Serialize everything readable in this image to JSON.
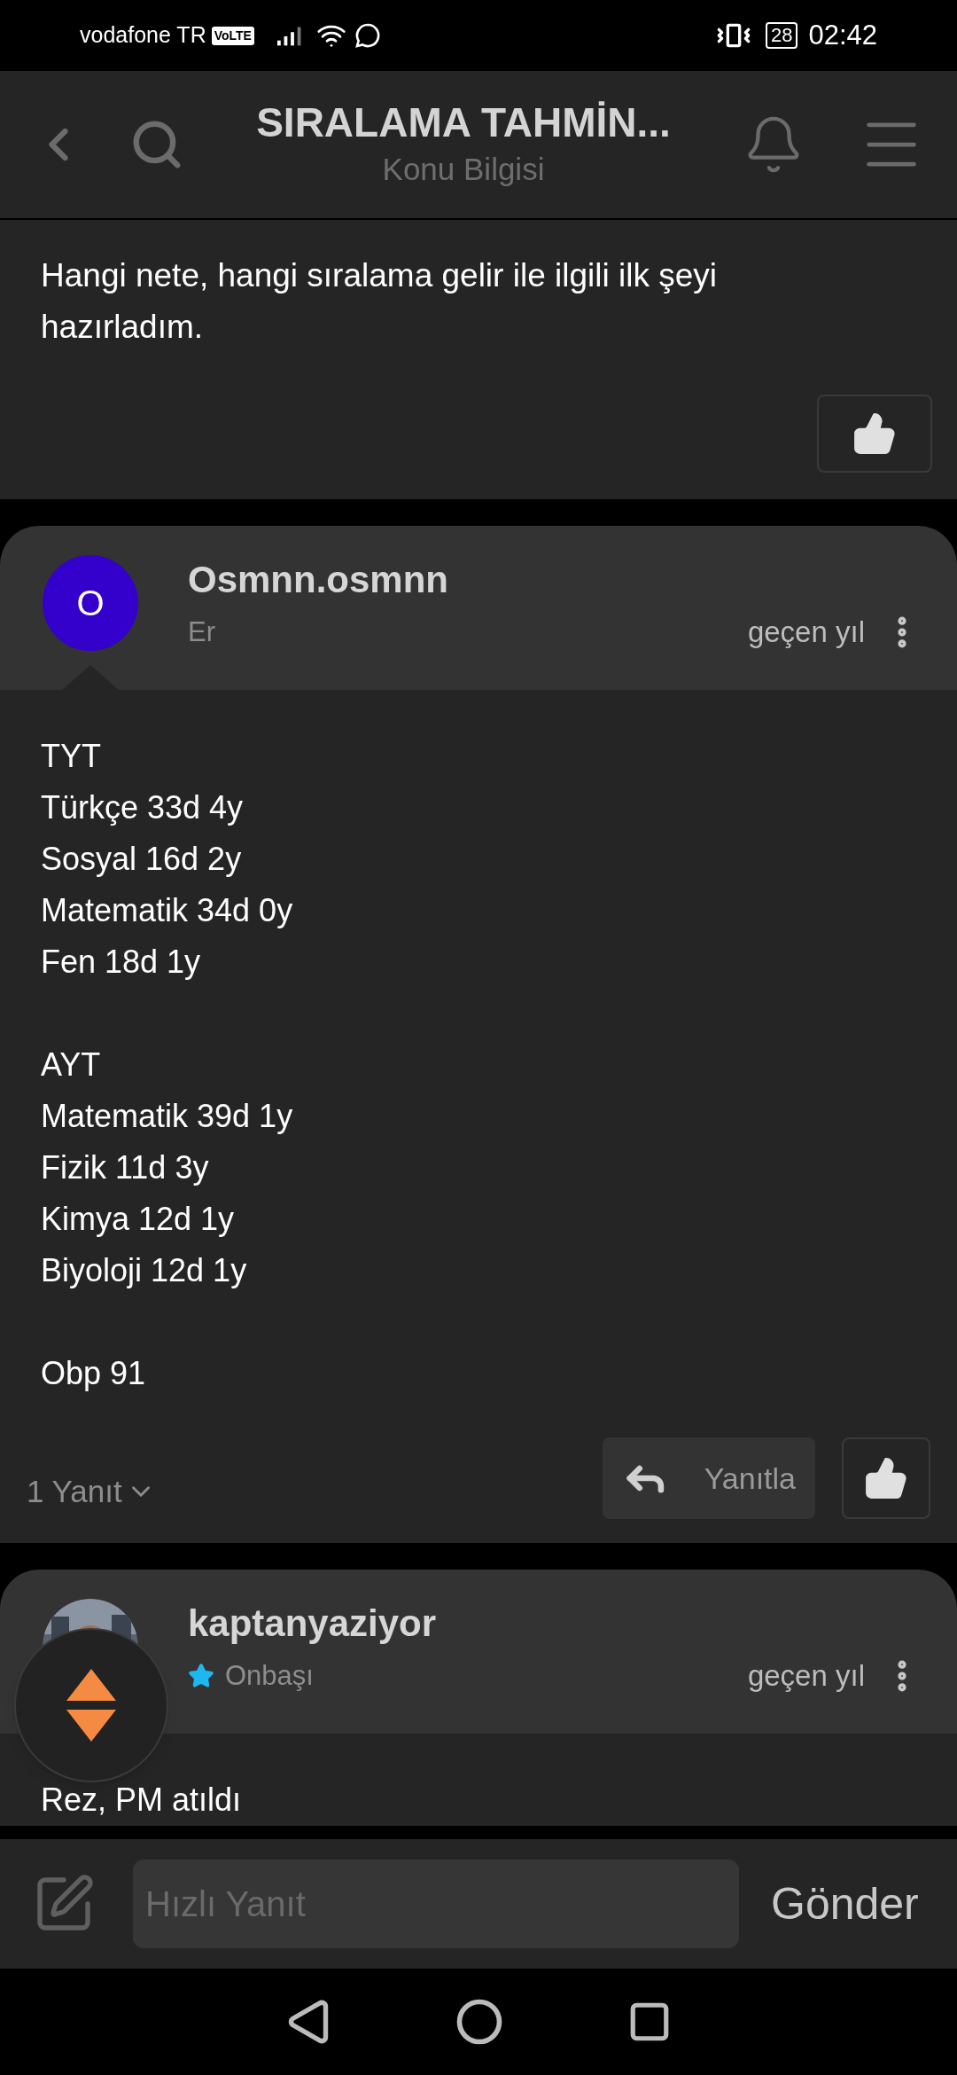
{
  "status_bar": {
    "carrier": "vodafone TR",
    "network_badge": "VoLTE",
    "battery": "28",
    "time": "02:42"
  },
  "header": {
    "title": "SIRALAMA TAHMİN...",
    "subtitle": "Konu Bilgisi"
  },
  "topic_post": {
    "text": "Hangi nete, hangi sıralama gelir ile ilgili ilk şeyi hazırladım."
  },
  "posts": [
    {
      "author": "Osmnn.osmnn",
      "avatar": {
        "kind": "initial",
        "text": "O",
        "color": "#3300cc"
      },
      "rank": "Er",
      "rank_star": false,
      "time": "geçen yıl",
      "paragraphs": [
        [
          "TYT",
          "Türkçe 33d 4y",
          "Sosyal 16d 2y",
          "Matematik 34d 0y",
          "Fen 18d 1y"
        ],
        [
          "AYT",
          "Matematik 39d 1y",
          "Fizik 11d 3y",
          "Kimya 12d 1y",
          "Biyoloji 12d 1y"
        ],
        [
          "Obp 91"
        ]
      ],
      "replies": "1 Yanıt",
      "reply_button": "Yanıtla"
    },
    {
      "author": "kaptanyaziyor",
      "avatar": {
        "kind": "picture"
      },
      "rank": "Onbaşı",
      "rank_star": true,
      "time": "geçen yıl",
      "paragraphs": [
        [
          "Rez, PM atıldı"
        ]
      ]
    }
  ],
  "quick_reply": {
    "placeholder": "Hızlı Yanıt",
    "send": "Gönder"
  }
}
